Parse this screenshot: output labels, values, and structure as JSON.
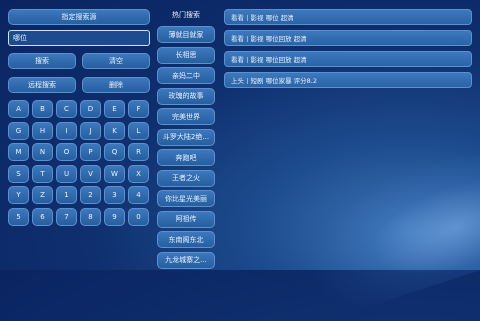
{
  "left_panel": {
    "title": "指定搜索源",
    "search_input_value": "哪位",
    "search_label": "搜索",
    "clear_label": "清空",
    "remote_search_label": "远程搜索",
    "delete_label": "删除",
    "keys": [
      [
        "A",
        "B",
        "C",
        "D",
        "E",
        "F"
      ],
      [
        "G",
        "H",
        "I",
        "J",
        "K",
        "L"
      ],
      [
        "M",
        "N",
        "O",
        "P",
        "Q",
        "R"
      ],
      [
        "S",
        "T",
        "U",
        "V",
        "W",
        "X"
      ],
      [
        "Y",
        "Z",
        "1",
        "2",
        "3",
        "4"
      ],
      [
        "5",
        "6",
        "7",
        "8",
        "9",
        "0"
      ]
    ]
  },
  "hot": {
    "title": "热门搜索",
    "items": [
      "薄就目就家",
      "长相思",
      "亲妈二中",
      "玫瑰的故事",
      "完美世界",
      "斗罗大陆2绝...",
      "奔跑吧",
      "王者之火",
      "你比星光美丽",
      "阿祖传",
      "东南阁东北",
      "九龙城寨之..."
    ]
  },
  "results": [
    "看看丨影视  哪位  超清",
    "看看丨影视  哪位回放  超清",
    "看看丨影视  哪位回放  超清",
    "上头丨短剧  哪位家暴  评分8.2"
  ]
}
